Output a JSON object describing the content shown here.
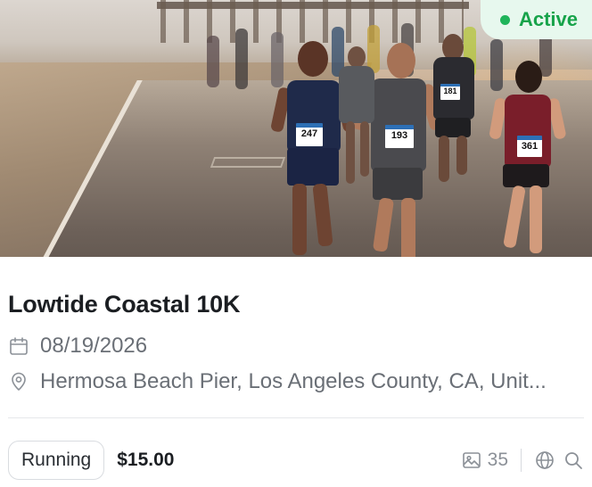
{
  "status": {
    "label": "Active",
    "color": "#17a34a"
  },
  "event": {
    "title": "Lowtide Coastal 10K",
    "date": "08/19/2026",
    "location": "Hermosa Beach Pier, Los Angeles County, CA, Unit..."
  },
  "hero": {
    "bibs": [
      "247",
      "193",
      "361",
      "181"
    ]
  },
  "footer": {
    "category": "Running",
    "price": "$15.00",
    "photo_count": "35"
  },
  "icons": {
    "date": "calendar-icon",
    "location": "map-pin-icon",
    "photos": "image-icon",
    "website": "globe-icon",
    "search": "search-icon"
  }
}
